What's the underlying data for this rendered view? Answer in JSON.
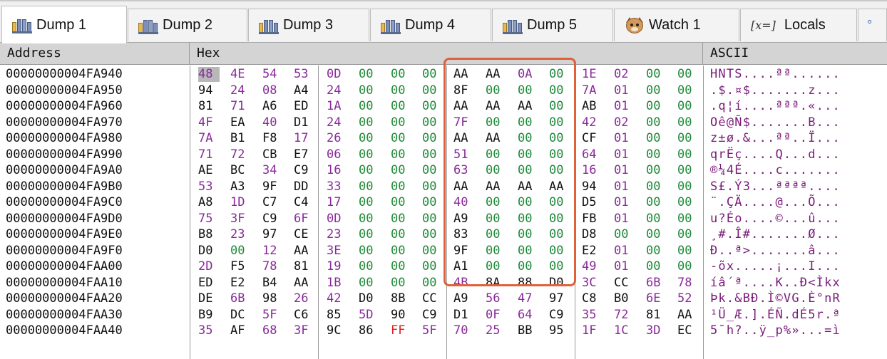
{
  "tabs": [
    {
      "label": "Dump 1",
      "icon": "memory-dump-icon",
      "active": true
    },
    {
      "label": "Dump 2",
      "icon": "memory-dump-icon",
      "active": false
    },
    {
      "label": "Dump 3",
      "icon": "memory-dump-icon",
      "active": false
    },
    {
      "label": "Dump 4",
      "icon": "memory-dump-icon",
      "active": false
    },
    {
      "label": "Dump 5",
      "icon": "memory-dump-icon",
      "active": false
    },
    {
      "label": "Watch 1",
      "icon": "watch-owl-icon",
      "active": false
    },
    {
      "label": "Locals",
      "icon_text": "[x=]",
      "active": false
    },
    {
      "label": "",
      "icon_text": "°",
      "active": false
    }
  ],
  "columns": {
    "address": "Address",
    "hex": "Hex",
    "ascii": "ASCII"
  },
  "colors": {
    "highlight_box": "#e0603a",
    "ascii_text": "#7a1a7a",
    "green_byte": "#1f8a3a",
    "purple_byte": "#8a2a9a"
  },
  "rows": [
    {
      "address": "00000000004FA940",
      "bytes": [
        "48",
        "4E",
        "54",
        "53",
        "0D",
        "00",
        "00",
        "00",
        "AA",
        "AA",
        "0A",
        "00",
        "1E",
        "02",
        "00",
        "00"
      ],
      "ascii": "HNTS....ªª......"
    },
    {
      "address": "00000000004FA950",
      "bytes": [
        "94",
        "24",
        "08",
        "A4",
        "24",
        "00",
        "00",
        "00",
        "8F",
        "00",
        "00",
        "00",
        "7A",
        "01",
        "00",
        "00"
      ],
      "ascii": ".$.¤$.......z..."
    },
    {
      "address": "00000000004FA960",
      "bytes": [
        "81",
        "71",
        "A6",
        "ED",
        "1A",
        "00",
        "00",
        "00",
        "AA",
        "AA",
        "AA",
        "00",
        "AB",
        "01",
        "00",
        "00"
      ],
      "ascii": ".q¦í....ªªª.«..."
    },
    {
      "address": "00000000004FA970",
      "bytes": [
        "4F",
        "EA",
        "40",
        "D1",
        "24",
        "00",
        "00",
        "00",
        "7F",
        "00",
        "00",
        "00",
        "42",
        "02",
        "00",
        "00"
      ],
      "ascii": "Oê@Ñ$.......B..."
    },
    {
      "address": "00000000004FA980",
      "bytes": [
        "7A",
        "B1",
        "F8",
        "17",
        "26",
        "00",
        "00",
        "00",
        "AA",
        "AA",
        "00",
        "00",
        "CF",
        "01",
        "00",
        "00"
      ],
      "ascii": "z±ø.&...ªª..Ï..."
    },
    {
      "address": "00000000004FA990",
      "bytes": [
        "71",
        "72",
        "CB",
        "E7",
        "06",
        "00",
        "00",
        "00",
        "51",
        "00",
        "00",
        "00",
        "64",
        "01",
        "00",
        "00"
      ],
      "ascii": "qrËç....Q...d..."
    },
    {
      "address": "00000000004FA9A0",
      "bytes": [
        "AE",
        "BC",
        "34",
        "C9",
        "16",
        "00",
        "00",
        "00",
        "63",
        "00",
        "00",
        "00",
        "16",
        "01",
        "00",
        "00"
      ],
      "ascii": "®¼4É....c......."
    },
    {
      "address": "00000000004FA9B0",
      "bytes": [
        "53",
        "A3",
        "9F",
        "DD",
        "33",
        "00",
        "00",
        "00",
        "AA",
        "AA",
        "AA",
        "AA",
        "94",
        "01",
        "00",
        "00"
      ],
      "ascii": "S£.Ý3...ªªªª...."
    },
    {
      "address": "00000000004FA9C0",
      "bytes": [
        "A8",
        "1D",
        "C7",
        "C4",
        "17",
        "00",
        "00",
        "00",
        "40",
        "00",
        "00",
        "00",
        "D5",
        "01",
        "00",
        "00"
      ],
      "ascii": "¨.ÇÄ....@...Õ..."
    },
    {
      "address": "00000000004FA9D0",
      "bytes": [
        "75",
        "3F",
        "C9",
        "6F",
        "0D",
        "00",
        "00",
        "00",
        "A9",
        "00",
        "00",
        "00",
        "FB",
        "01",
        "00",
        "00"
      ],
      "ascii": "u?Éo....©...û..."
    },
    {
      "address": "00000000004FA9E0",
      "bytes": [
        "B8",
        "23",
        "97",
        "CE",
        "23",
        "00",
        "00",
        "00",
        "83",
        "00",
        "00",
        "00",
        "D8",
        "00",
        "00",
        "00"
      ],
      "ascii": "¸#.Î#.......Ø..."
    },
    {
      "address": "00000000004FA9F0",
      "bytes": [
        "D0",
        "00",
        "12",
        "AA",
        "3E",
        "00",
        "00",
        "00",
        "9F",
        "00",
        "00",
        "00",
        "E2",
        "01",
        "00",
        "00"
      ],
      "ascii": "Ð..ª>.......â..."
    },
    {
      "address": "00000000004FAA00",
      "bytes": [
        "2D",
        "F5",
        "78",
        "81",
        "19",
        "00",
        "00",
        "00",
        "A1",
        "00",
        "00",
        "00",
        "49",
        "01",
        "00",
        "00"
      ],
      "ascii": "-õx.....¡...I..."
    },
    {
      "address": "00000000004FAA10",
      "bytes": [
        "ED",
        "E2",
        "B4",
        "AA",
        "1B",
        "00",
        "00",
        "00",
        "4B",
        "8A",
        "88",
        "D0",
        "3C",
        "CC",
        "6B",
        "78"
      ],
      "ascii": "íâ´ª....K..Ð<Ìkx"
    },
    {
      "address": "00000000004FAA20",
      "bytes": [
        "DE",
        "6B",
        "98",
        "26",
        "42",
        "D0",
        "8B",
        "CC",
        "A9",
        "56",
        "47",
        "97",
        "C8",
        "B0",
        "6E",
        "52"
      ],
      "ascii": "Þk.&BÐ.Ì©VG.È°nR"
    },
    {
      "address": "00000000004FAA30",
      "bytes": [
        "B9",
        "DC",
        "5F",
        "C6",
        "85",
        "5D",
        "90",
        "C9",
        "D1",
        "0F",
        "64",
        "C9",
        "35",
        "72",
        "81",
        "AA"
      ],
      "ascii": "¹Ü_Æ.].ÉÑ.dÉ5r.ª"
    },
    {
      "address": "00000000004FAA40",
      "bytes": [
        "35",
        "AF",
        "68",
        "3F",
        "9C",
        "86",
        "FF",
        "5F",
        "70",
        "25",
        "BB",
        "95",
        "1F",
        "1C",
        "3D",
        "EC"
      ],
      "ascii": "5¯h?..ÿ_p%»...=ì"
    }
  ]
}
